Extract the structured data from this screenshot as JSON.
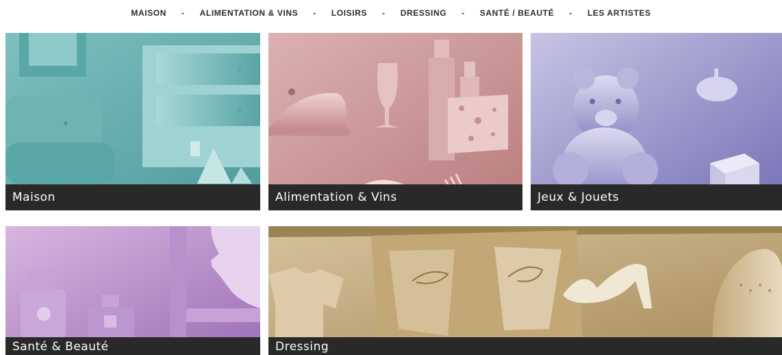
{
  "nav": {
    "items": [
      {
        "label": "MAISON"
      },
      {
        "label": "ALIMENTATION & VINS"
      },
      {
        "label": "LOISIRS"
      },
      {
        "label": "DRESSING"
      },
      {
        "label": "SANTÉ / BEAUTÉ"
      },
      {
        "label": "LES ARTISTES"
      }
    ],
    "separator": "-"
  },
  "tiles": {
    "maison": {
      "label": "Maison",
      "color": "#6fb3b3"
    },
    "alimentation": {
      "label": "Alimentation & Vins",
      "color": "#c48a8a"
    },
    "jeux": {
      "label": "Jeux & Jouets",
      "color": "#8a86c2"
    },
    "sante": {
      "label": "Santé & Beauté",
      "color": "#b58ac7"
    },
    "dressing": {
      "label": "Dressing",
      "color": "#c4aa7c"
    }
  }
}
